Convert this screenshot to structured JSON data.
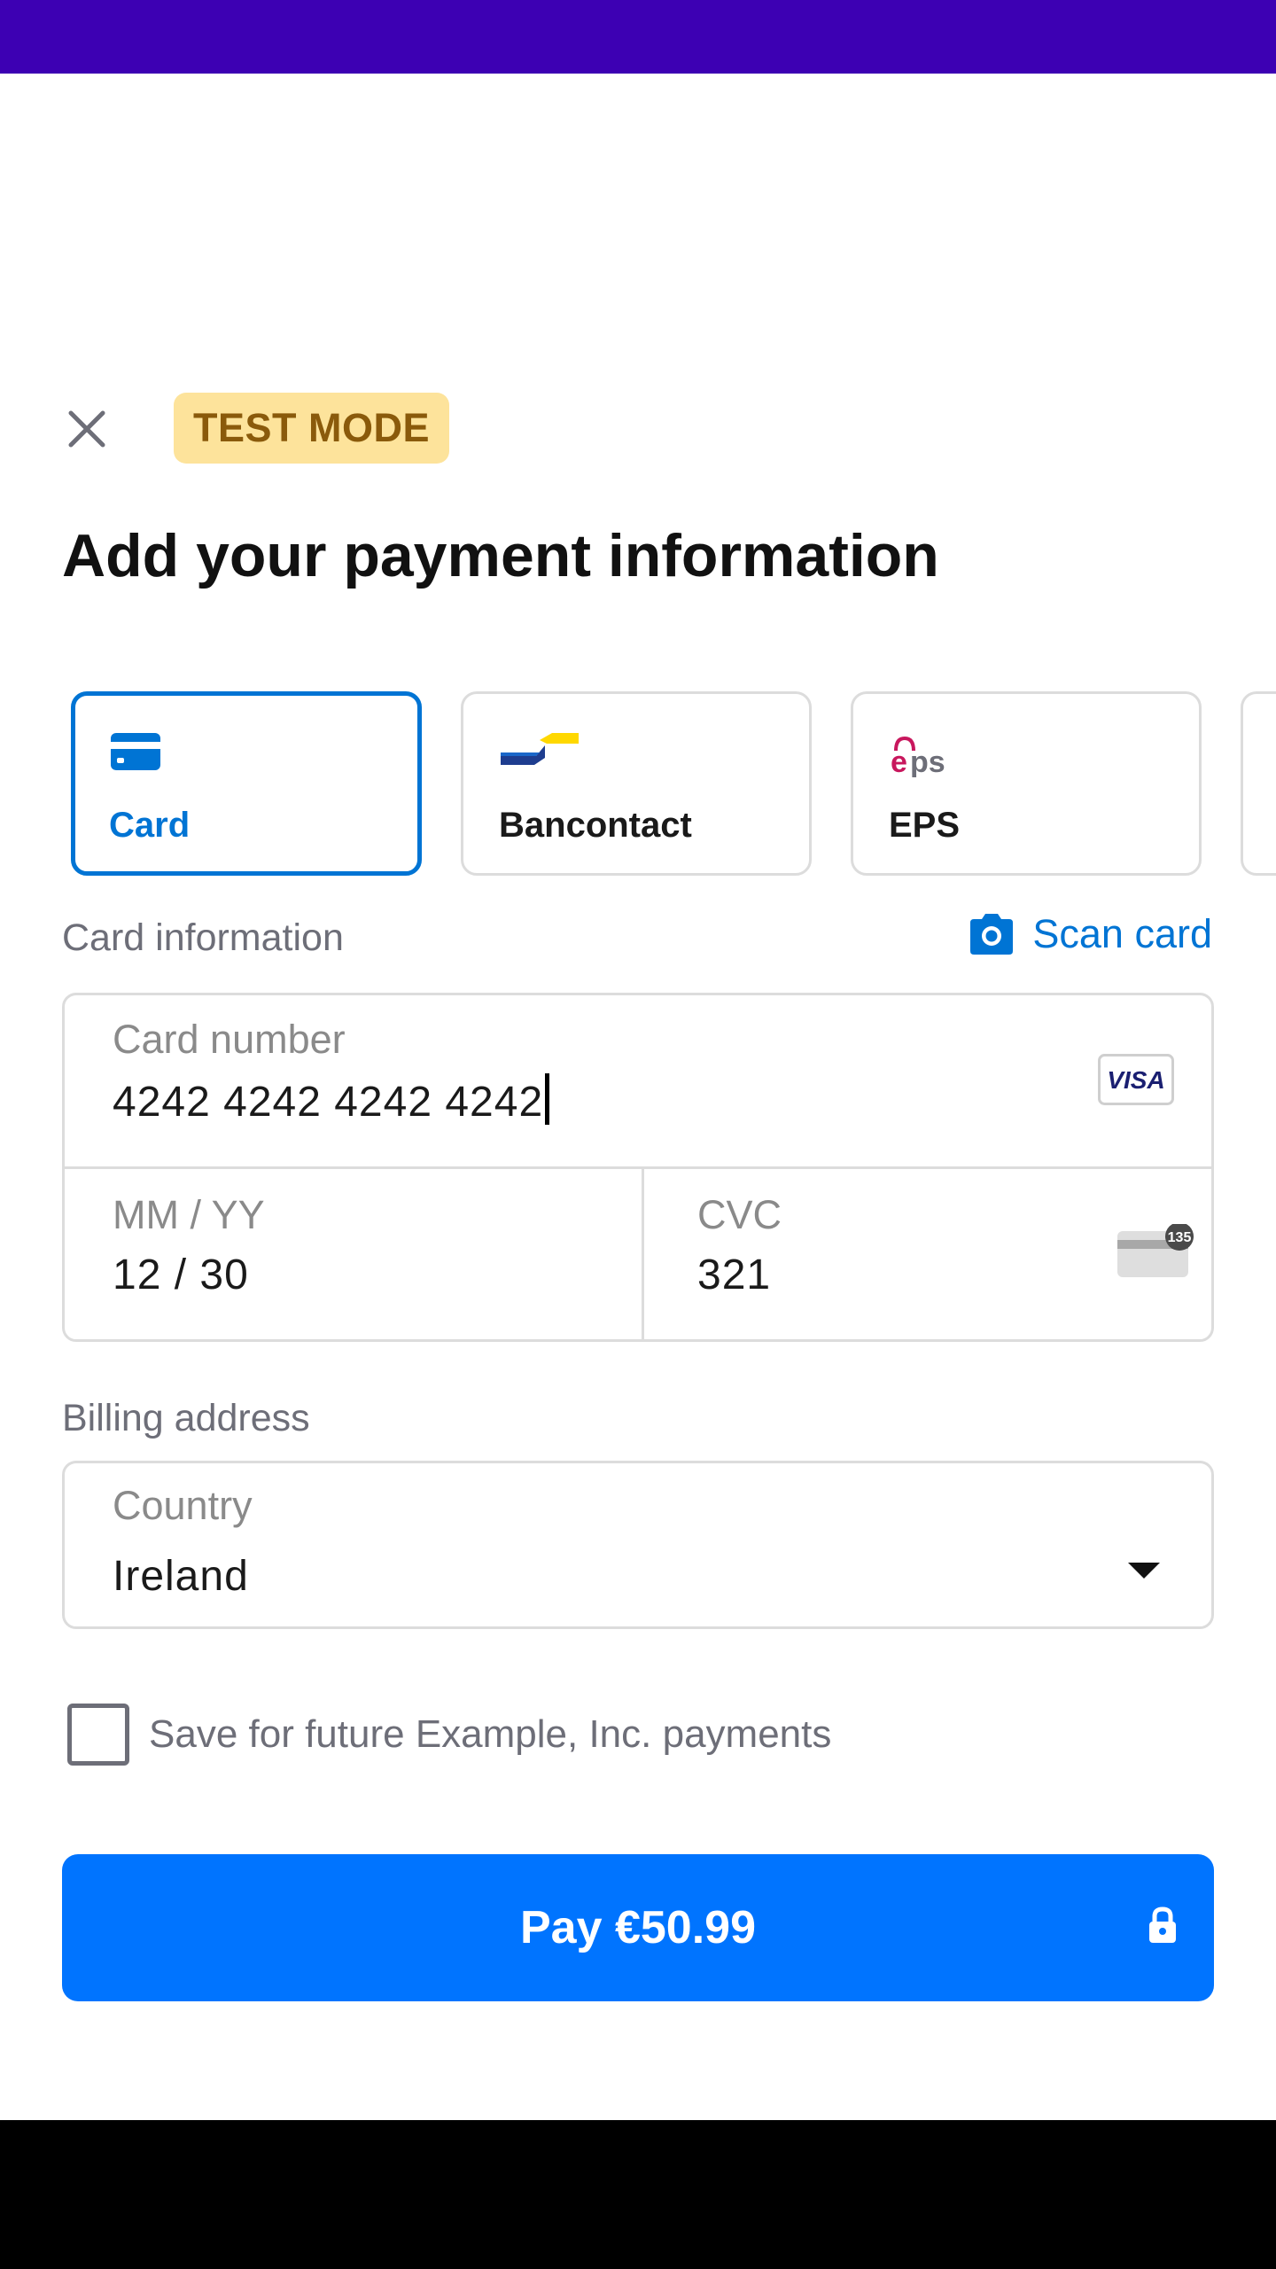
{
  "header": {
    "close_icon": "close-icon",
    "badge": "TEST MODE",
    "title": "Add your payment information"
  },
  "payment_methods": [
    {
      "label": "Card",
      "icon": "card-icon",
      "selected": true
    },
    {
      "label": "Bancontact",
      "icon": "bancontact-logo",
      "selected": false
    },
    {
      "label": "EPS",
      "icon": "eps-logo",
      "selected": false
    }
  ],
  "card_section": {
    "label": "Card information",
    "scan_label": "Scan card",
    "scan_icon": "camera-icon",
    "number_label": "Card number",
    "number_value": "4242 4242 4242 4242",
    "brand": "VISA",
    "expiry_label": "MM / YY",
    "expiry_value": "12 / 30",
    "cvc_label": "CVC",
    "cvc_value": "321",
    "cvc_hint": "135"
  },
  "billing": {
    "label": "Billing address",
    "country_label": "Country",
    "country_value": "Ireland"
  },
  "save": {
    "label": "Save for future Example, Inc. payments",
    "checked": false
  },
  "pay_button": {
    "label": "Pay €50.99",
    "icon": "lock-icon"
  },
  "colors": {
    "accent": "#0074d4",
    "button": "#0074ff",
    "status_bar": "#3d00b3",
    "badge_bg": "#fde39b"
  }
}
